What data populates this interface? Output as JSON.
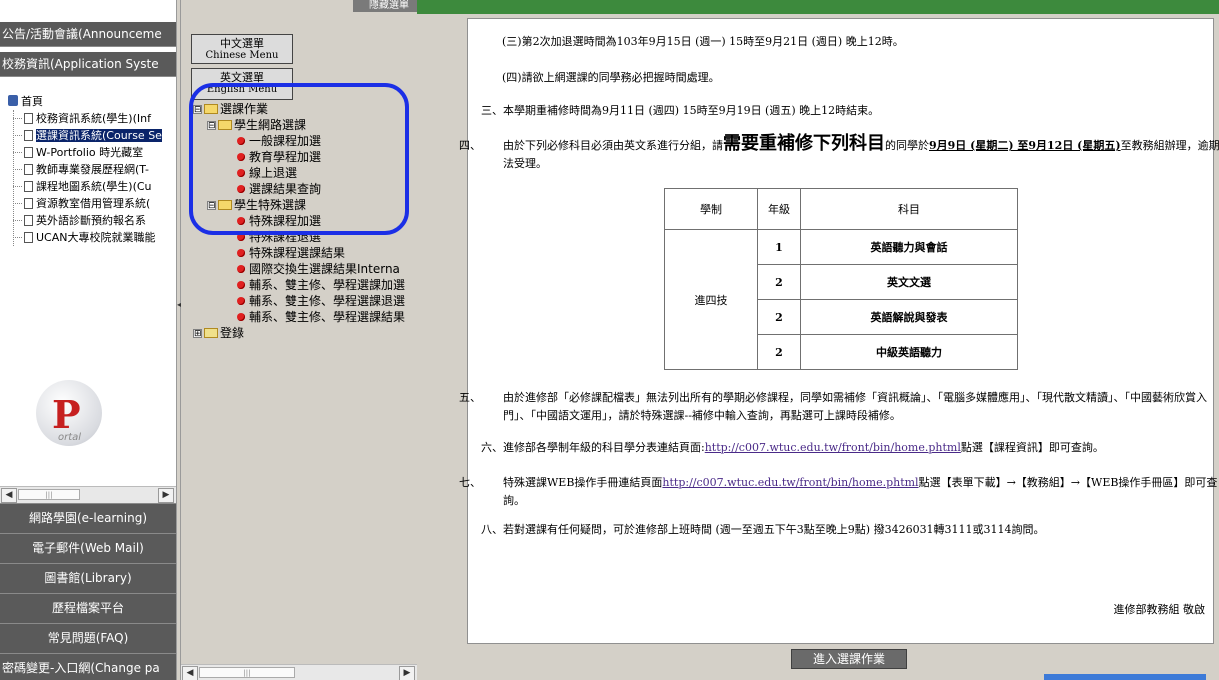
{
  "left_nav": {
    "top_items": [
      "公告/活動會議(Announceme",
      "校務資訊(Application Syste"
    ],
    "tree": {
      "root": "首頁",
      "items": [
        "校務資訊系統(學生)(Inf",
        "選課資訊系統(Course Se",
        "W-Portfolio 時光藏室",
        "教師專業發展歷程網(T-",
        "課程地圖系統(學生)(Cu",
        "資源教室借用管理系統(",
        "英外語診斷預約報名系",
        "UCAN大專校院就業職能"
      ]
    },
    "logo": {
      "letter": "P",
      "text": "ortal"
    },
    "bottom_items": [
      "網路學園(e-learning)",
      "電子郵件(Web Mail)",
      "圖書館(Library)",
      "歷程檔案平台",
      "常見問題(FAQ)",
      "密碼變更-入口網(Change pa"
    ]
  },
  "menu_frame": {
    "top_button": "隱藏選單",
    "chinese_menu": {
      "zh": "中文選單",
      "en": "Chinese Menu"
    },
    "english_menu": {
      "zh": "英文選單",
      "en": "English Menu"
    },
    "tree": {
      "root": "選課作業",
      "group1": "學生網路選課",
      "group1_items": [
        "一般課程加選",
        "教育學程加選",
        "線上退選",
        "選課結果查詢"
      ],
      "group2": "學生特殊選課",
      "group2_items": [
        "特殊課程加選",
        "特殊課程退選",
        "特殊課程選課結果",
        "國際交換生選課結果Interna",
        "輔系、雙主修、學程選課加選",
        "輔系、雙主修、學程選課退選",
        "輔系、雙主修、學程選課結果"
      ],
      "root2": "登錄"
    },
    "toggles": {
      "expanded": "⊟",
      "collapsed": "⊞"
    }
  },
  "content": {
    "p_san": "(三)第2次加退選時間為103年9月15日 (週一) 15時至9月21日 (週日) 晚上12時。",
    "p_si": "(四)請欲上網選課的同學務必把握時間處理。",
    "item3": {
      "num": "三、",
      "text": "本學期重補修時間為9月11日 (週四) 15時至9月19日 (週五) 晚上12時結束。"
    },
    "item4": {
      "num": "四、",
      "pre": "由於下列必修科目必須由英文系進行分組，請",
      "emph": "需要重補修下列科目",
      "mid": "的同學於",
      "date": "9月9日 (星期二) 至9月12日 (星期五)",
      "post": "至教務組辦理，逾期無法受理。"
    },
    "table": {
      "headers": [
        "學制",
        "年級",
        "科目"
      ],
      "group_label": "進四技",
      "rows": [
        {
          "grade": "1",
          "subject": "英語聽力與會話"
        },
        {
          "grade": "2",
          "subject": "英文文選"
        },
        {
          "grade": "2",
          "subject": "英語解說與發表"
        },
        {
          "grade": "2",
          "subject": "中級英語聽力"
        }
      ]
    },
    "item5": {
      "num": "五、",
      "text": "由於進修部「必修課配檔表」無法列出所有的學期必修課程，同學如需補修「資訊概論」、「電腦多媒體應用」、「現代散文精讀」、「中國藝術欣賞入門」、「中國語文運用」，請於特殊選課--補修中輸入查詢，再點選可上課時段補修。"
    },
    "item6": {
      "num": "六、",
      "pre": "進修部各學制年級的科目學分表連結頁面:",
      "link": "http://c007.wtuc.edu.tw/front/bin/home.phtml",
      "post": "點選【課程資訊】即可查詢。"
    },
    "item7": {
      "num": "七、",
      "pre": "特殊選課WEB操作手冊連結頁面",
      "link": "http://c007.wtuc.edu.tw/front/bin/home.phtml",
      "post": "點選【表單下載】→【教務組】→【WEB操作手冊區】即可查詢。"
    },
    "item8": {
      "num": "八、",
      "text": "若對選課有任何疑問，可於進修部上班時間 (週一至週五下午3點至晚上9點) 撥3426031轉3111或3114詢問。"
    },
    "signature": "進修部教務組 敬啟",
    "enter_button": "進入選課作業"
  },
  "colors": {
    "nav_bg": "#5a5a5a",
    "selection": "#0a246a",
    "highlight_ring": "#1b2fe6",
    "frame_bg": "#d4d0c8",
    "bullet": "#e02020"
  }
}
